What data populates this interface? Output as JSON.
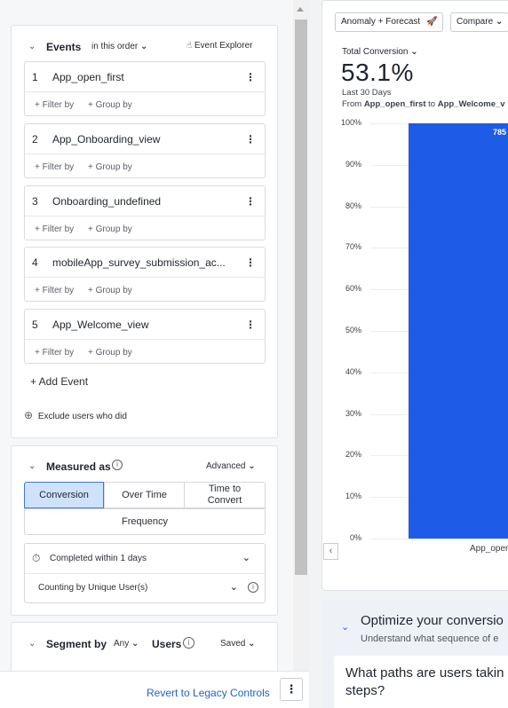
{
  "events_section": {
    "title": "Events",
    "order_label": "in this order",
    "explorer_label": "Event Explorer",
    "filter_label": "+ Filter by",
    "group_label": "+ Group by",
    "events": [
      {
        "num": "1",
        "name": "App_open_first"
      },
      {
        "num": "2",
        "name": "App_Onboarding_view"
      },
      {
        "num": "3",
        "name": "Onboarding_undefined"
      },
      {
        "num": "4",
        "name": "mobileApp_survey_submission_ac..."
      },
      {
        "num": "5",
        "name": "App_Welcome_view"
      }
    ],
    "add_event": "+ Add Event",
    "exclude_label": "Exclude users who did"
  },
  "measured_section": {
    "title": "Measured as",
    "advanced_label": "Advanced",
    "tabs": [
      "Conversion",
      "Over Time",
      "Time to Convert",
      "Frequency"
    ],
    "active_tab": "Conversion",
    "completed_within": "Completed within 1 days",
    "counting_by": "Counting by Unique User(s)"
  },
  "segment_section": {
    "title": "Segment by",
    "any_label": "Any",
    "users_label": "Users",
    "saved_label": "Saved"
  },
  "bottom": {
    "revert_label": "Revert to Legacy Controls",
    "more_label": "⋮"
  },
  "toolbar": {
    "anomaly_label": "Anomaly + Forecast",
    "compare_label": "Compare"
  },
  "metric": {
    "label": "Total Conversion",
    "value": "53.1%",
    "period": "Last 30 Days",
    "from_prefix": "From ",
    "from_event": "App_open_first",
    "to_word": " to ",
    "to_event": "App_Welcome_v"
  },
  "chart_data": {
    "type": "bar",
    "categories": [
      "App_open_first"
    ],
    "visible_category_label": "App_oper",
    "values": [
      100
    ],
    "data_labels": [
      "785"
    ],
    "yticks": [
      "100%",
      "90%",
      "80%",
      "70%",
      "60%",
      "50%",
      "40%",
      "30%",
      "20%",
      "10%",
      "0%"
    ],
    "ylim": [
      0,
      100
    ],
    "bar_color": "#1e5be6"
  },
  "optimize": {
    "title": "Optimize your conversio",
    "subtitle": "Understand what sequence of e",
    "question": "What paths are users takin steps?"
  },
  "colors": {
    "accent": "#2563c7",
    "active_tab_bg": "#cfe2fb"
  }
}
